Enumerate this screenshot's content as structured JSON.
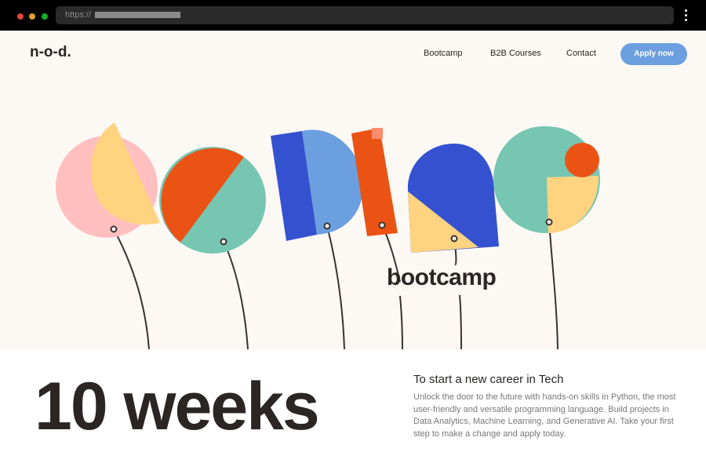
{
  "browser": {
    "url_prefix": "https://",
    "dot_colors": [
      "#e0443e",
      "#dea123",
      "#1aab29"
    ]
  },
  "nav": {
    "logo": "n-o-d.",
    "links": [
      "Bootcamp",
      "B2B Courses",
      "Contact"
    ],
    "cta": "Apply now"
  },
  "hero": {
    "art_word": "bootcamp",
    "colors": {
      "pink": "#ffbfbf",
      "yellow": "#ffd37f",
      "orange": "#eb5315",
      "teal": "#76c6b2",
      "blue": "#3452cf",
      "light_blue": "#6b9fe0",
      "string": "#3a3130",
      "background": "#fcf9f5"
    }
  },
  "main": {
    "headline": "10 weeks",
    "subheading": "To start a new career in Tech",
    "description": "Unlock the door to the future with hands-on skills in Python, the most user-friendly and versatile programming language. Build projects in Data Analytics, Machine Learning, and Generative AI. Take your first step to make a change and apply today."
  }
}
